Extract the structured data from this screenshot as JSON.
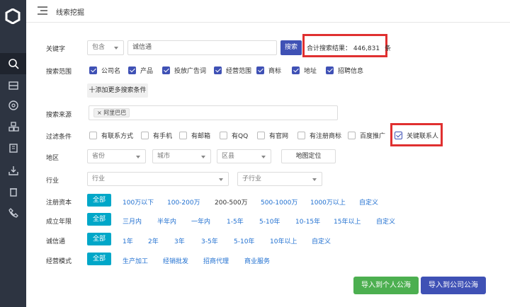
{
  "header": {
    "title": "线索挖掘"
  },
  "keyword": {
    "label": "关键字",
    "mode": "包含",
    "value": "诚信通",
    "search_label": "搜索",
    "result_prefix": "合计搜索结果：",
    "result_count": "446,831",
    "result_unit": "条"
  },
  "scope": {
    "label": "搜索范围",
    "options": [
      {
        "label": "公司名",
        "checked": true
      },
      {
        "label": "产品",
        "checked": true
      },
      {
        "label": "投放广告词",
        "checked": true
      },
      {
        "label": "经营范围",
        "checked": true
      },
      {
        "label": "商标",
        "checked": true
      },
      {
        "label": "地址",
        "checked": true
      },
      {
        "label": "招聘信息",
        "checked": true
      }
    ]
  },
  "add_more": {
    "label": "十添加更多搜索条件"
  },
  "source": {
    "label": "搜索来源",
    "tags": [
      "× 阿里巴巴"
    ]
  },
  "filters": {
    "label": "过滤条件",
    "options": [
      {
        "label": "有联系方式",
        "checked": false
      },
      {
        "label": "有手机",
        "checked": false
      },
      {
        "label": "有邮箱",
        "checked": false
      },
      {
        "label": "有QQ",
        "checked": false
      },
      {
        "label": "有官网",
        "checked": false
      },
      {
        "label": "有注册商标",
        "checked": false
      },
      {
        "label": "百度推广",
        "checked": false
      },
      {
        "label": "关键联系人",
        "checked": true
      }
    ]
  },
  "region": {
    "label": "地区",
    "province": "省份",
    "city": "城市",
    "district": "区县",
    "map_label": "地图定位"
  },
  "industry": {
    "label": "行业",
    "primary": "行业",
    "secondary": "子行业"
  },
  "capital": {
    "label": "注册资本",
    "options": [
      "全部",
      "100万以下",
      "100-200万",
      "200-500万",
      "500-1000万",
      "1000万以上",
      "自定义"
    ]
  },
  "established": {
    "label": "成立年限",
    "options": [
      "全部",
      "三月内",
      "半年内",
      "一年内",
      "1-5年",
      "5-10年",
      "10-15年",
      "15年以上",
      "自定义"
    ]
  },
  "chengxintong": {
    "label": "诚信通",
    "options": [
      "全部",
      "1年",
      "2年",
      "3年",
      "3-5年",
      "5-10年",
      "10年以上",
      "自定义"
    ]
  },
  "business_mode": {
    "label": "经营模式",
    "options": [
      "全部",
      "生产加工",
      "经销批发",
      "招商代理",
      "商业服务"
    ]
  },
  "actions": {
    "import_personal": "导入到个人公海",
    "import_company": "导入到公司公海"
  },
  "colors": {
    "sidebar": "#2d3441",
    "primary": "#3f51b5",
    "accent": "#00a7c8",
    "green": "#4caf50",
    "highlight": "#e03030",
    "link": "#1f6fd0"
  }
}
